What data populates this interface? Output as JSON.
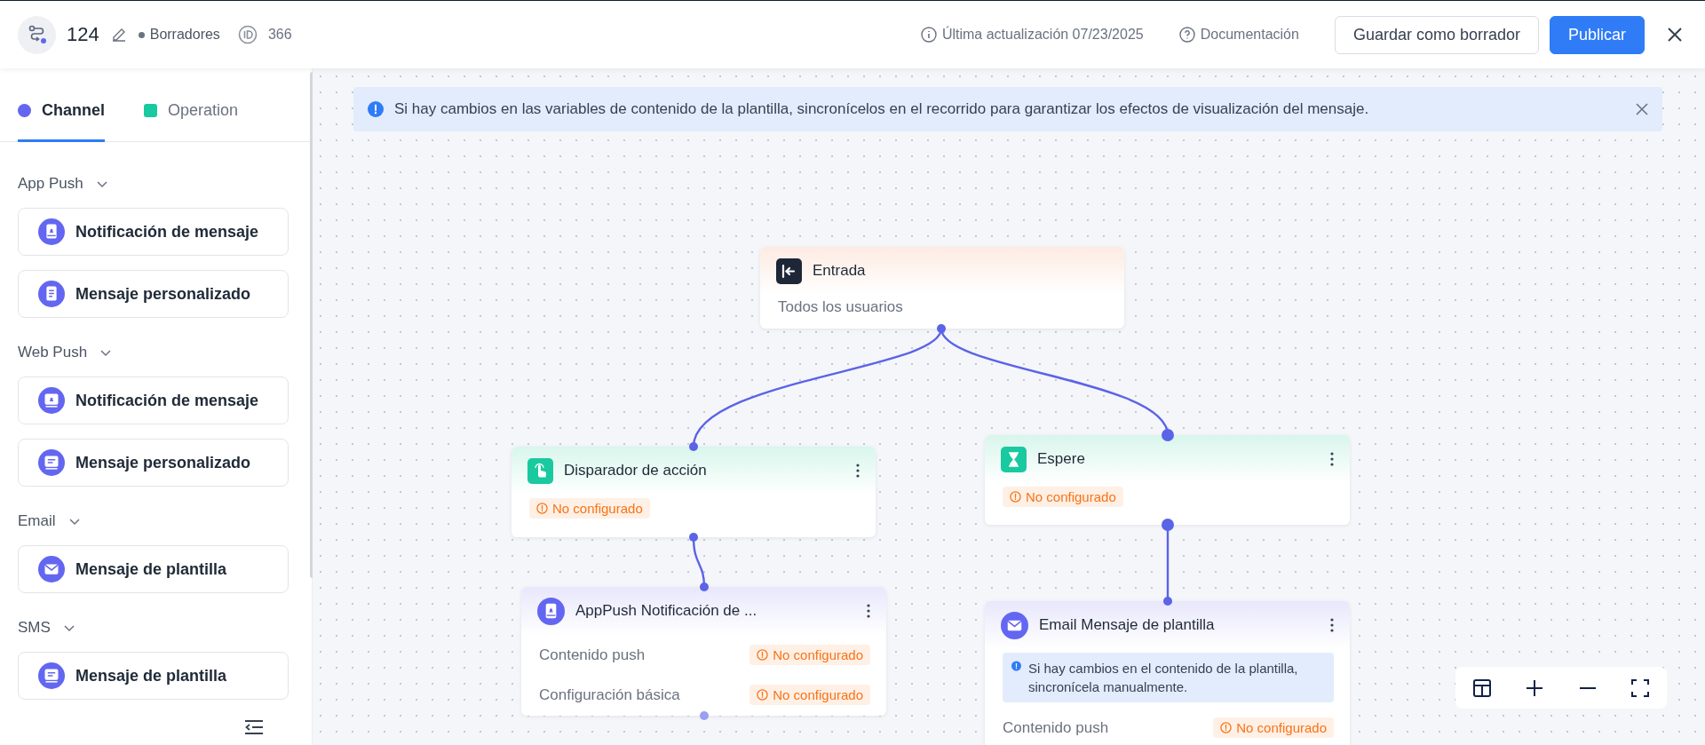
{
  "header": {
    "title": "124",
    "status": "Borradores",
    "id": "366",
    "updated": "Última actualización 07/23/2025",
    "docs": "Documentación",
    "buttons": [
      {
        "label": "Guardar como borrador",
        "kind": "outline"
      },
      {
        "label": "Publicar",
        "kind": "primary"
      }
    ]
  },
  "sidebar": {
    "tabs": [
      {
        "label": "Channel",
        "selected": true,
        "kind": "channel",
        "color": "#6366f1"
      },
      {
        "label": "Operation",
        "selected": false,
        "kind": "operation",
        "color": "#19c9a0"
      }
    ],
    "groups": [
      {
        "title": "App Push",
        "expanded": true,
        "items": [
          {
            "label": "Notificación de mensaje",
            "kind": "phone-bell"
          },
          {
            "label": "Mensaje personalizado",
            "kind": "document"
          }
        ]
      },
      {
        "title": "Web Push",
        "expanded": true,
        "items": [
          {
            "label": "Notificación de mensaje",
            "kind": "screen-bell"
          },
          {
            "label": "Mensaje personalizado",
            "kind": "message"
          }
        ]
      },
      {
        "title": "Email",
        "expanded": true,
        "items": [
          {
            "label": "Mensaje de plantilla",
            "kind": "mail"
          }
        ]
      },
      {
        "title": "SMS",
        "expanded": true,
        "items": [
          {
            "label": "Mensaje de plantilla",
            "kind": "message"
          }
        ]
      }
    ]
  },
  "banner": {
    "text": "Si hay cambios en las variables de contenido de la plantilla, sincronícelos en el recorrido para garantizar los efectos de visualización del mensaje."
  },
  "nodes": [
    {
      "kind": "entry",
      "title": "Entrada",
      "subtitle": "Todos los usuarios"
    },
    {
      "kind": "trigger",
      "title": "Disparador de acción",
      "badge": "No configurado"
    },
    {
      "kind": "wait",
      "title": "Espere",
      "badge": "No configurado"
    },
    {
      "kind": "app-push",
      "title": "AppPush Notificación de ...",
      "rows": [
        {
          "label": "Contenido push",
          "status": "No configurado"
        },
        {
          "label": "Configuración básica",
          "status": "No configurado"
        }
      ]
    },
    {
      "kind": "email",
      "title": "Email Mensaje de plantilla",
      "note": "Si hay cambios en el contenido de la plantilla, sincronícela manualmente.",
      "rows": [
        {
          "label": "Contenido push",
          "status": "No configurado"
        }
      ]
    }
  ]
}
